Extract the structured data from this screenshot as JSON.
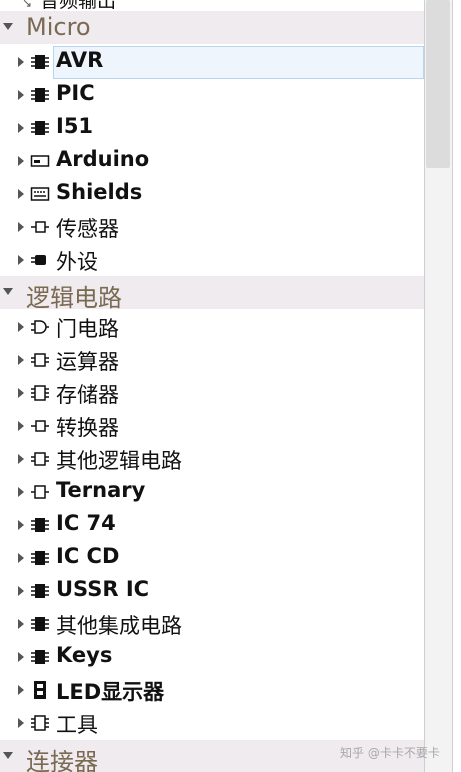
{
  "partial_top_item": "音频输出",
  "categories": {
    "micro": "Micro",
    "logic": "逻辑电路",
    "connector": "连接器"
  },
  "items": [
    {
      "label": "AVR",
      "icon": "chip-icon",
      "bold": true,
      "selected": true
    },
    {
      "label": "PIC",
      "icon": "chip-icon",
      "bold": true
    },
    {
      "label": "I51",
      "icon": "chip-icon",
      "bold": true
    },
    {
      "label": "Arduino",
      "icon": "board-icon",
      "bold": true
    },
    {
      "label": "Shields",
      "icon": "shield-board-icon",
      "bold": true
    },
    {
      "label": "传感器",
      "icon": "sensor-icon",
      "bold": false
    },
    {
      "label": "外设",
      "icon": "peripheral-icon",
      "bold": false
    },
    {
      "label": "门电路",
      "icon": "gate-icon",
      "bold": false
    },
    {
      "label": "运算器",
      "icon": "ic-outline-icon",
      "bold": false
    },
    {
      "label": "存储器",
      "icon": "ic-outline-icon",
      "bold": false
    },
    {
      "label": "转换器",
      "icon": "converter-icon",
      "bold": false
    },
    {
      "label": "其他逻辑电路",
      "icon": "ic-outline-icon",
      "bold": false
    },
    {
      "label": "Ternary",
      "icon": "ic-outline-icon",
      "bold": true
    },
    {
      "label": "IC 74",
      "icon": "chip-icon",
      "bold": true
    },
    {
      "label": "IC CD",
      "icon": "chip-icon",
      "bold": true
    },
    {
      "label": "USSR IC",
      "icon": "chip-icon",
      "bold": true
    },
    {
      "label": "其他集成电路",
      "icon": "chip-icon",
      "bold": false
    },
    {
      "label": "Keys",
      "icon": "chip-icon",
      "bold": true
    },
    {
      "label": "LED显示器",
      "icon": "seven-segment-icon",
      "bold": true
    },
    {
      "label": "工具",
      "icon": "ic-outline-icon",
      "bold": false
    }
  ],
  "watermark": "知乎 @卡卡不要卡"
}
